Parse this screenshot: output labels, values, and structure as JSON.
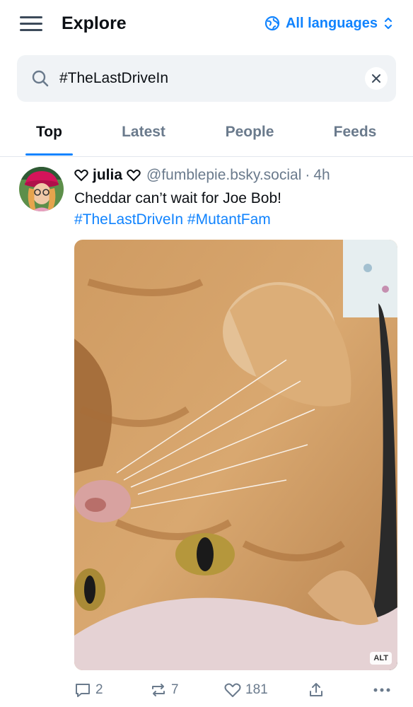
{
  "header": {
    "title": "Explore",
    "language_label": "All languages"
  },
  "search": {
    "value": "#TheLastDriveIn",
    "placeholder": "Search"
  },
  "tabs": [
    {
      "label": "Top",
      "active": true
    },
    {
      "label": "Latest",
      "active": false
    },
    {
      "label": "People",
      "active": false
    },
    {
      "label": "Feeds",
      "active": false
    }
  ],
  "post": {
    "author": "julia",
    "handle": "@fumblepie.bsky.social",
    "separator": "·",
    "time": "4h",
    "text": "Cheddar can’t wait for Joe Bob!",
    "hashtags": [
      "#TheLastDriveIn",
      "#MutantFam"
    ],
    "alt_label": "ALT",
    "reply_count": "2",
    "repost_count": "7",
    "like_count": "181"
  },
  "colors": {
    "accent": "#1083fe",
    "muted": "#6a7a8c",
    "search_bg": "#f0f3f6"
  }
}
